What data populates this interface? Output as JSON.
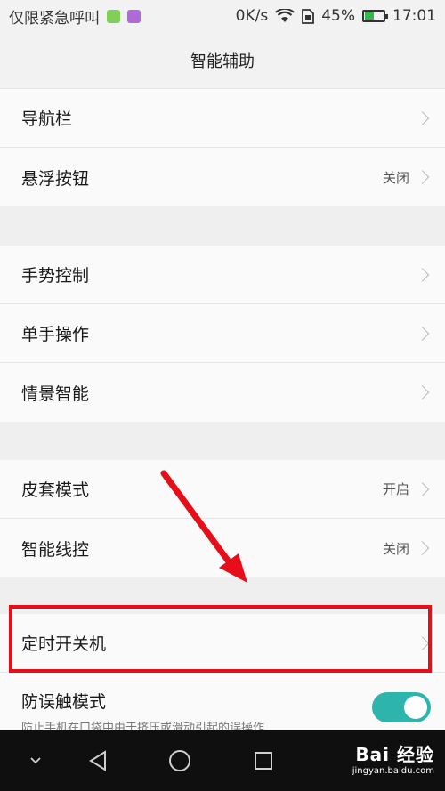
{
  "status_bar": {
    "carrier": "仅限紧急呼叫",
    "speed": "0K/s",
    "battery": "45%",
    "time": "17:01"
  },
  "title": "智能辅助",
  "groups": [
    {
      "items": [
        {
          "label": "导航栏",
          "value": ""
        },
        {
          "label": "悬浮按钮",
          "value": "关闭"
        }
      ]
    },
    {
      "items": [
        {
          "label": "手势控制",
          "value": ""
        },
        {
          "label": "单手操作",
          "value": ""
        },
        {
          "label": "情景智能",
          "value": ""
        }
      ]
    },
    {
      "items": [
        {
          "label": "皮套模式",
          "value": "开启"
        },
        {
          "label": "智能线控",
          "value": "关闭"
        }
      ]
    },
    {
      "items": [
        {
          "label": "定时开关机",
          "value": ""
        },
        {
          "label": "防误触模式",
          "sub": "防止手机在口袋中由于挤压或滑动引起的误操作",
          "toggle": "on"
        }
      ]
    }
  ],
  "watermark": {
    "main": "Bai 经验",
    "sub": "jingyan.baidu.com"
  },
  "colors": {
    "accent": "#2db5ad",
    "highlight": "#e60f19",
    "navbar": "#0f0f0f"
  },
  "icons": [
    "wifi-icon",
    "sim-icon",
    "battery-icon",
    "chevron-right-icon",
    "nav-down-icon",
    "nav-back-icon",
    "nav-home-icon",
    "nav-recent-icon"
  ]
}
